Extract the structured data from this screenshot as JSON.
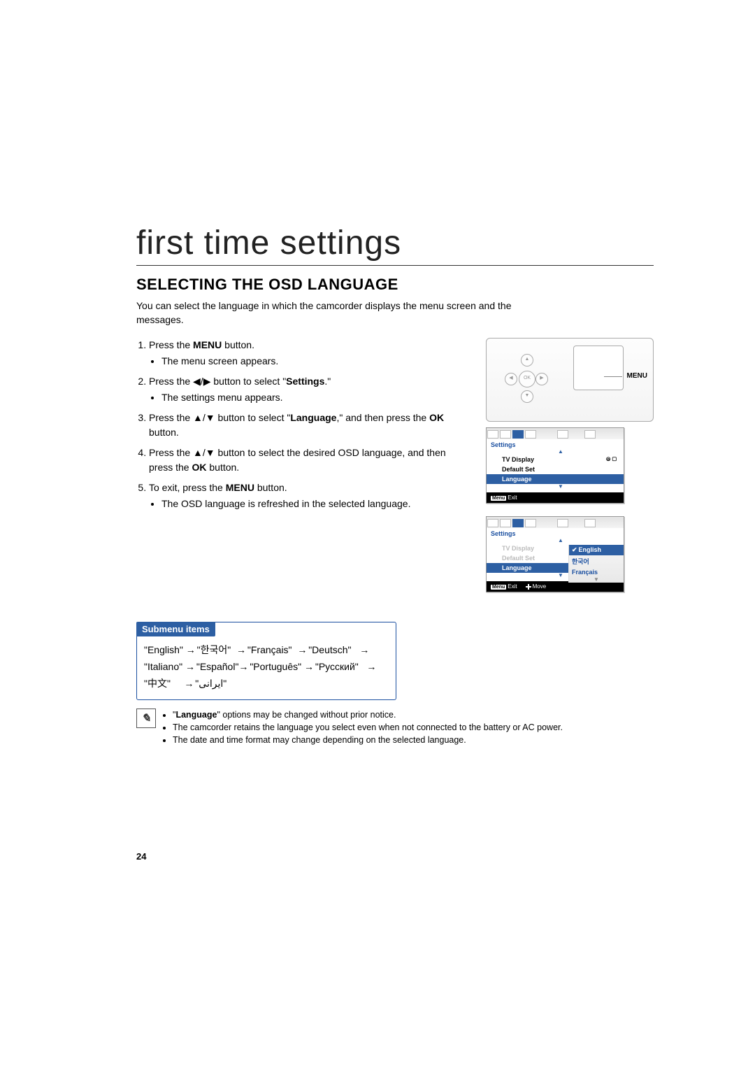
{
  "page": {
    "heading": "first time settings",
    "section_title": "SELECTING THE OSD LANGUAGE",
    "intro": "You can select the language in which the camcorder displays the menu screen and the messages.",
    "page_number": "24"
  },
  "steps": {
    "s1_a": "Press the ",
    "s1_b": "MENU",
    "s1_c": " button.",
    "s1_sub": "The menu screen appears.",
    "s2_a": "Press the ",
    "s2_icons": "◀/▶",
    "s2_b": " button to select \"",
    "s2_c": "Settings",
    "s2_d": ".\"",
    "s2_sub": "The settings menu appears.",
    "s3_a": "Press the ",
    "s3_icons": "▲/▼",
    "s3_b": " button to select \"",
    "s3_c": "Language",
    "s3_d": ",\" and then press the ",
    "s3_e": "OK",
    "s3_f": " button.",
    "s4_a": "Press the ",
    "s4_icons": "▲/▼",
    "s4_b": " button to select the desired OSD language, and then press the ",
    "s4_c": "OK",
    "s4_d": " button.",
    "s5_a": "To exit, press the ",
    "s5_b": "MENU",
    "s5_c": " button.",
    "s5_sub": "The OSD language is refreshed in the selected language."
  },
  "device": {
    "ok": "OK",
    "menu_label": "MENU"
  },
  "osd1": {
    "settings": "Settings",
    "row1": "TV Display",
    "row2": "Default Set",
    "row3": "Language",
    "foot_menu": "Menu",
    "foot_exit": "Exit"
  },
  "osd2": {
    "settings": "Settings",
    "row1": "TV Display",
    "row2": "Default Set",
    "row3": "Language",
    "opt1": "English",
    "opt2": "한국어",
    "opt3": "Français",
    "foot_menu": "Menu",
    "foot_exit": "Exit",
    "foot_move": "Move"
  },
  "submenu": {
    "title": "Submenu items",
    "l1a": "\"English\"",
    "l1b": "\"한국어\"",
    "l1c": "\"Français\"",
    "l1d": "\"Deutsch\"",
    "l2a": "\"Italiano\"",
    "l2b": "\"Español\"",
    "l2c": "\"Português\"",
    "l2d": "\"Русский\"",
    "l3a": "\"中文\"",
    "l3b": "\"ایرانی\""
  },
  "notes": {
    "n1_a": "\"",
    "n1_b": "Language",
    "n1_c": "\" options may be changed without prior notice.",
    "n2": "The camcorder retains the language you select even when not connected to the battery or AC power.",
    "n3": "The date and time format may change depending on the selected language."
  }
}
